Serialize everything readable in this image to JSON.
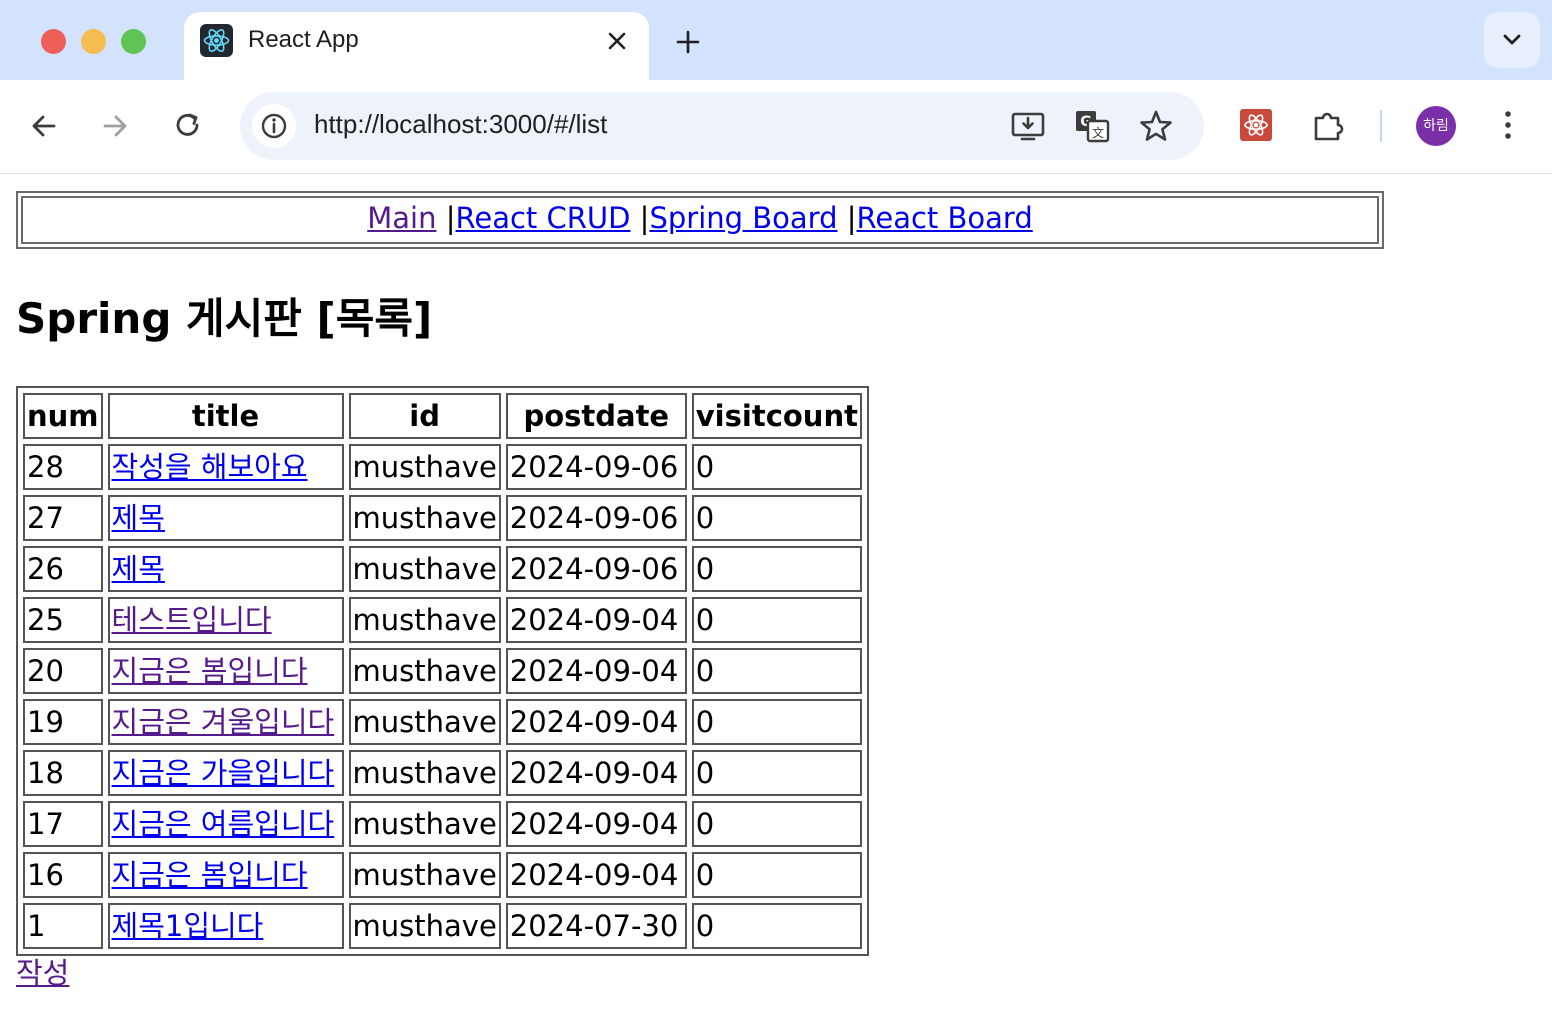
{
  "browser": {
    "tab_title": "React App",
    "url": "http://localhost:3000/#/list",
    "profile_initial": "하림",
    "icons": [
      "react-favicon-icon",
      "close-icon",
      "plus-icon",
      "chevron-down-icon",
      "back-arrow-icon",
      "forward-arrow-icon",
      "reload-icon",
      "site-info-icon",
      "install-app-icon",
      "translate-icon",
      "star-icon",
      "react-devtools-icon",
      "extensions-icon",
      "kebab-menu-icon"
    ]
  },
  "nav": {
    "links": [
      {
        "label": "Main",
        "sep": " |"
      },
      {
        "label": "React CRUD",
        "sep": " |"
      },
      {
        "label": "Spring Board",
        "sep": " |"
      },
      {
        "label": "React Board",
        "sep": ""
      }
    ]
  },
  "page": {
    "heading": "Spring 게시판 [목록]",
    "write_link": "작성"
  },
  "table": {
    "headers": [
      "num",
      "title",
      "id",
      "postdate",
      "visitcount"
    ],
    "rows": [
      {
        "num": "28",
        "title": "작성을 해보아요",
        "id": "musthave",
        "postdate": "2024-09-06",
        "visitcount": "0"
      },
      {
        "num": "27",
        "title": "제목",
        "id": "musthave",
        "postdate": "2024-09-06",
        "visitcount": "0"
      },
      {
        "num": "26",
        "title": "제목",
        "id": "musthave",
        "postdate": "2024-09-06",
        "visitcount": "0"
      },
      {
        "num": "25",
        "title": "테스트입니다",
        "id": "musthave",
        "postdate": "2024-09-04",
        "visitcount": "0"
      },
      {
        "num": "20",
        "title": "지금은 봄입니다",
        "id": "musthave",
        "postdate": "2024-09-04",
        "visitcount": "0"
      },
      {
        "num": "19",
        "title": "지금은 겨울입니다",
        "id": "musthave",
        "postdate": "2024-09-04",
        "visitcount": "0"
      },
      {
        "num": "18",
        "title": "지금은 가을입니다",
        "id": "musthave",
        "postdate": "2024-09-04",
        "visitcount": "0"
      },
      {
        "num": "17",
        "title": "지금은 여름입니다",
        "id": "musthave",
        "postdate": "2024-09-04",
        "visitcount": "0"
      },
      {
        "num": "16",
        "title": "지금은 봄입니다",
        "id": "musthave",
        "postdate": "2024-09-04",
        "visitcount": "0"
      },
      {
        "num": "1",
        "title": "제목1입니다",
        "id": "musthave",
        "postdate": "2024-07-30",
        "visitcount": "0"
      }
    ]
  },
  "colors": {
    "link": "#0000ee",
    "visited_link": "#551a8b",
    "tabstrip": "#d3e3fd"
  }
}
